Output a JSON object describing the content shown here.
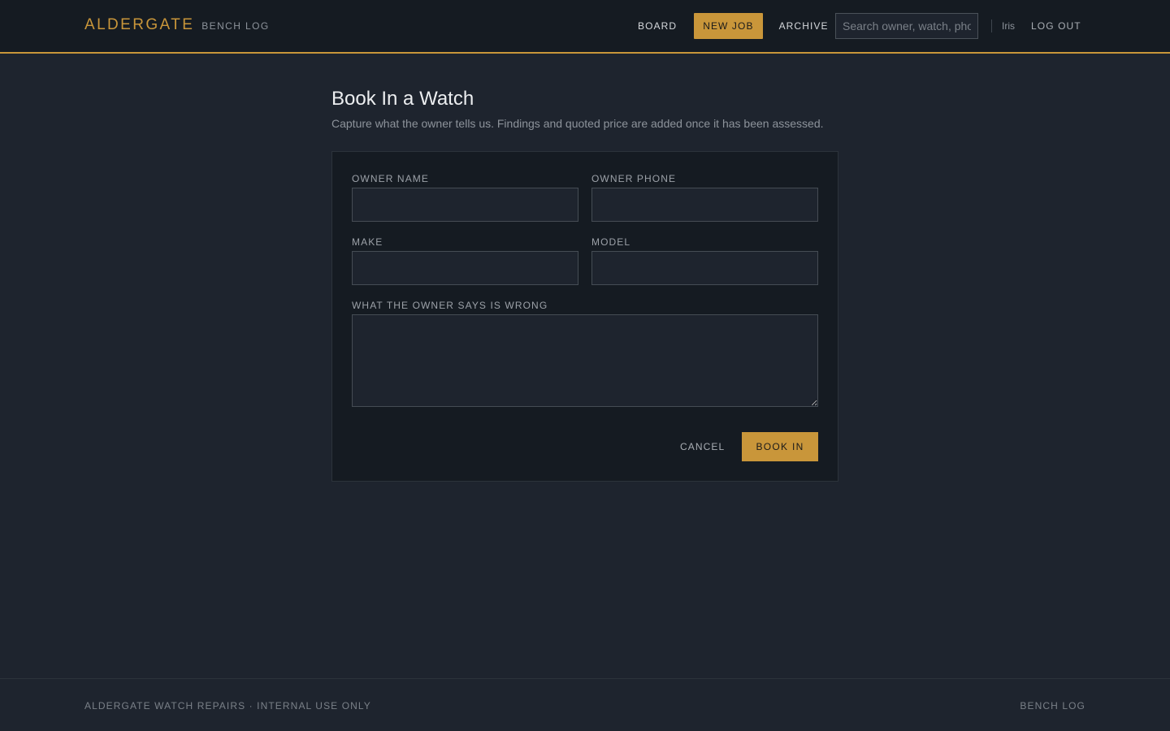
{
  "header": {
    "brand_name": "ALDERGATE",
    "brand_sub": "BENCH LOG",
    "nav": {
      "board": "BOARD",
      "new_job": "NEW JOB",
      "archive": "ARCHIVE"
    },
    "active_nav": "new_job",
    "search_placeholder": "Search owner, watch, phone",
    "search_value": "",
    "user_name": "Iris",
    "logout": "LOG OUT"
  },
  "page": {
    "title": "Book In a Watch",
    "subtitle": "Capture what the owner tells us. Findings and quoted price are added once it has been assessed."
  },
  "form": {
    "owner_name": {
      "label": "OWNER NAME",
      "value": ""
    },
    "owner_phone": {
      "label": "OWNER PHONE",
      "value": ""
    },
    "make": {
      "label": "MAKE",
      "value": ""
    },
    "model": {
      "label": "MODEL",
      "value": ""
    },
    "complaint": {
      "label": "WHAT THE OWNER SAYS IS WRONG",
      "value": ""
    },
    "cancel_label": "CANCEL",
    "submit_label": "BOOK IN"
  },
  "footer": {
    "left": "ALDERGATE WATCH REPAIRS · INTERNAL USE ONLY",
    "right": "BENCH LOG"
  },
  "colors": {
    "accent": "#c9963a",
    "background": "#1e242e",
    "panel": "#151b22"
  }
}
